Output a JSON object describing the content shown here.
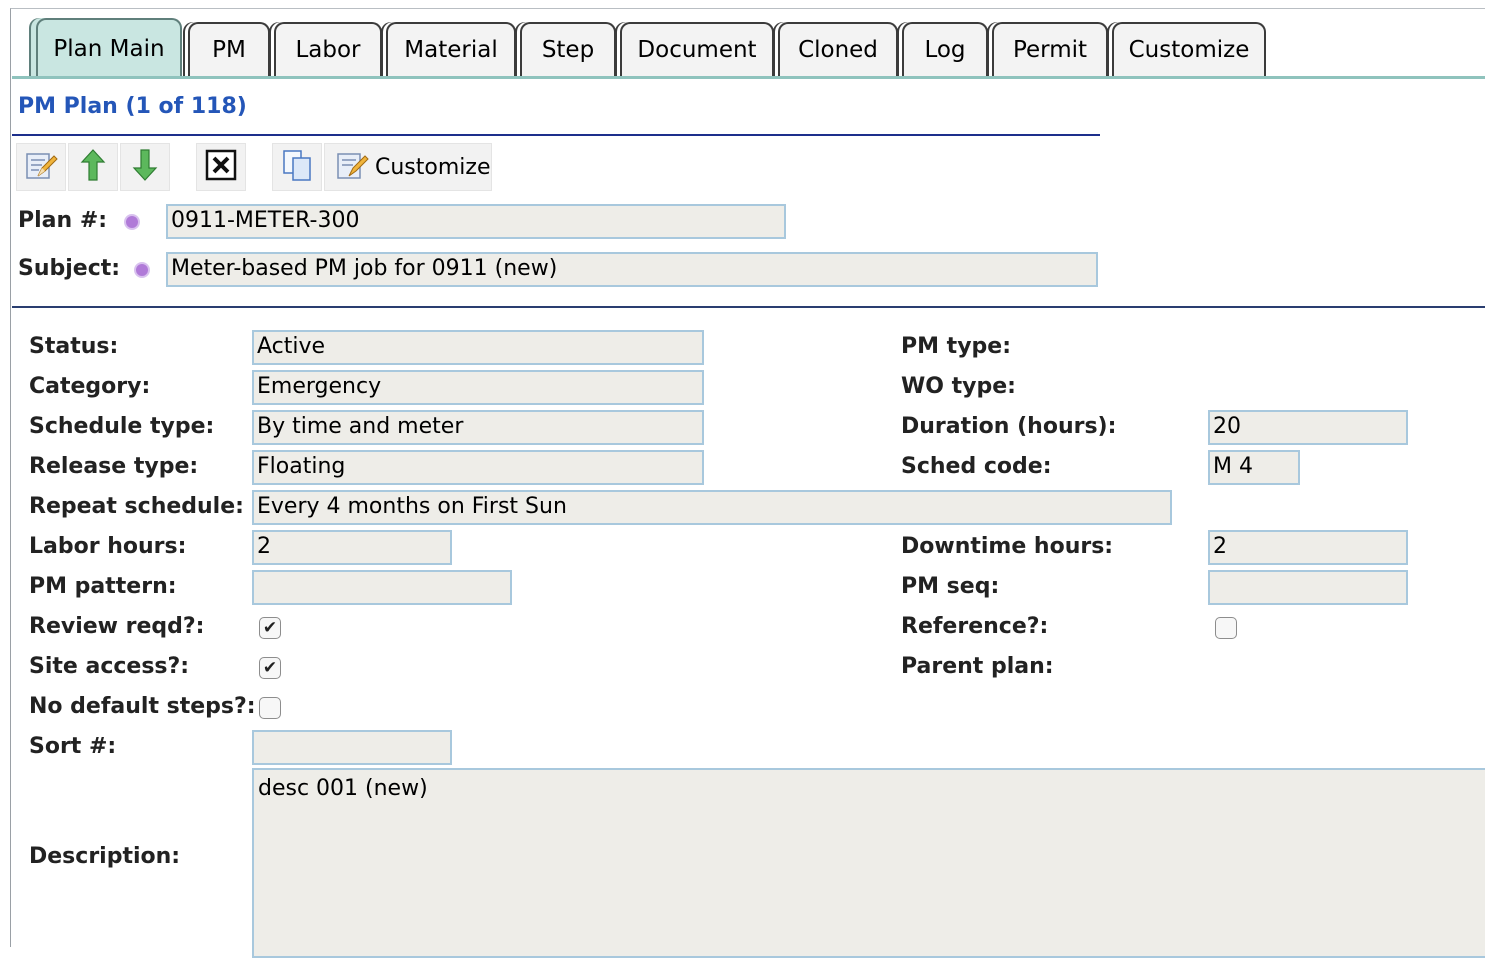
{
  "tabs": [
    {
      "label": "Plan Main",
      "active": true
    },
    {
      "label": "PM"
    },
    {
      "label": "Labor"
    },
    {
      "label": "Material"
    },
    {
      "label": "Step"
    },
    {
      "label": "Document"
    },
    {
      "label": "Cloned"
    },
    {
      "label": "Log"
    },
    {
      "label": "Permit"
    },
    {
      "label": "Customize"
    }
  ],
  "section_title": "PM Plan (1 of 118)",
  "toolbar": {
    "icons": [
      "edit-form-icon",
      "arrow-up-icon",
      "arrow-down-icon",
      "delete-icon",
      "copy-icon",
      "customize-icon"
    ],
    "customize_label": "Customize"
  },
  "header": {
    "plan_label": "Plan #:",
    "plan_value": "0911-METER-300",
    "subject_label": "Subject:",
    "subject_value": "Meter-based PM job for 0911 (new)"
  },
  "form": {
    "status_label": "Status:",
    "status_value": "Active",
    "category_label": "Category:",
    "category_value": "Emergency",
    "schedule_type_label": "Schedule type:",
    "schedule_type_value": "By time and meter",
    "release_type_label": "Release type:",
    "release_type_value": "Floating",
    "repeat_schedule_label": "Repeat schedule:",
    "repeat_schedule_value": "Every 4 months on First Sun",
    "labor_hours_label": "Labor hours:",
    "labor_hours_value": "2",
    "pm_pattern_label": "PM pattern:",
    "pm_pattern_value": "",
    "review_reqd_label": "Review reqd?:",
    "review_reqd_checked": true,
    "site_access_label": "Site access?:",
    "site_access_checked": true,
    "no_default_steps_label": "No default steps?:",
    "no_default_steps_checked": false,
    "sort_label": "Sort #:",
    "sort_value": "",
    "description_label": "Description:",
    "description_value": "desc 001 (new)",
    "pm_type_label": "PM type:",
    "wo_type_label": "WO type:",
    "duration_label": "Duration (hours):",
    "duration_value": "20",
    "sched_code_label": "Sched code:",
    "sched_code_value": "M 4",
    "downtime_label": "Downtime hours:",
    "downtime_value": "2",
    "pm_seq_label": "PM seq:",
    "pm_seq_value": "",
    "reference_label": "Reference?:",
    "reference_checked": false,
    "parent_plan_label": "Parent plan:"
  }
}
